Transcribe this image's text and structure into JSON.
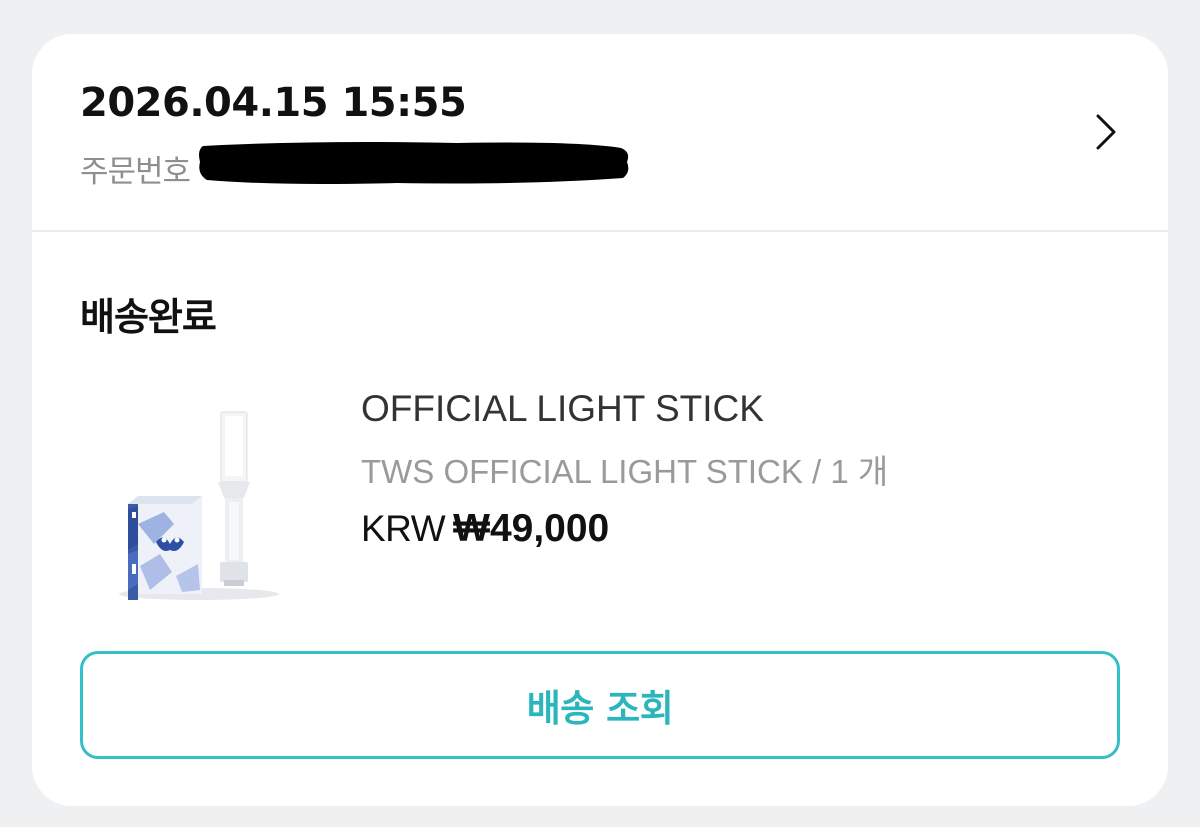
{
  "order": {
    "datetime": "2026.04.15 15:55",
    "number_label": "주문번호",
    "status": "배송완료"
  },
  "product": {
    "name": "OFFICIAL LIGHT STICK",
    "option": "TWS OFFICIAL LIGHT STICK / 1 개",
    "currency": "KRW",
    "price": "₩49,000",
    "image_icon": "light-stick-product-image"
  },
  "actions": {
    "track_label": "배송 조회"
  },
  "icons": {
    "detail": "chevron-right-icon"
  },
  "colors": {
    "accent": "#35bfc7",
    "accent_text": "#2bb5bd",
    "background": "#eff0f2",
    "card": "#ffffff",
    "redaction": "#000000"
  }
}
